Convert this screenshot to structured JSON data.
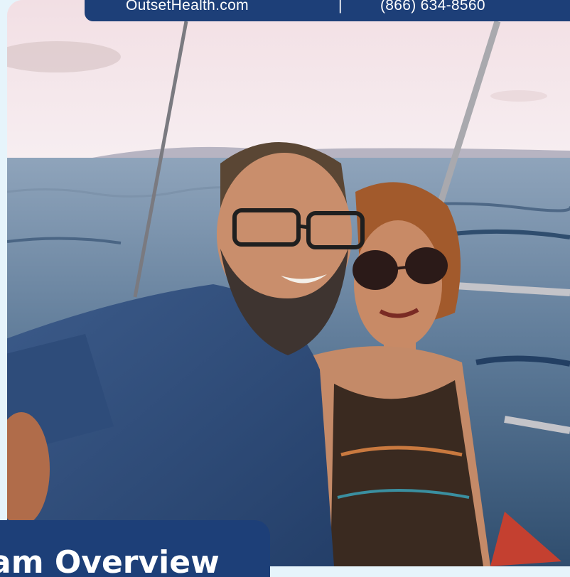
{
  "header": {
    "website": "OutsetHealth.com",
    "separator": "|",
    "phone": "(866) 634-8560"
  },
  "hero": {
    "title": "am Overview"
  },
  "colors": {
    "brand_navy": "#1d3f78",
    "frame_light_blue": "#e6f4fb",
    "text_white": "#ffffff"
  }
}
